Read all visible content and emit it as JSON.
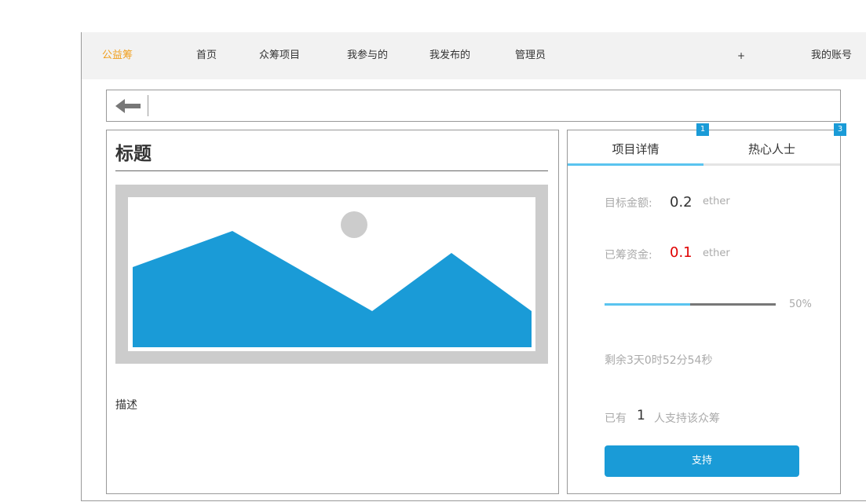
{
  "navbar": {
    "brand": "公益筹",
    "items": [
      "首页",
      "众筹项目",
      "我参与的",
      "我发布的",
      "管理员"
    ],
    "plus": "+",
    "account": "我的账号",
    "brand_color": "#f0a020",
    "background": "#f2f2f2"
  },
  "back": {
    "icon": "arrow-left-icon"
  },
  "project": {
    "title": "标题",
    "image_icon": "image-placeholder-icon",
    "description": "描述"
  },
  "tabs": {
    "items": [
      {
        "label": "项目详情",
        "badge": "1"
      },
      {
        "label": "热心人士",
        "badge": "3"
      }
    ],
    "active_index": 0,
    "accent": "#5ac4ef"
  },
  "details": {
    "target_label": "目标金额:",
    "target_value": "0.2",
    "target_unit": "ether",
    "raised_label": "已筹资金:",
    "raised_value": "0.1",
    "raised_unit": "ether",
    "raised_color": "#e00000",
    "progress_percent": 50,
    "progress_text": "50%",
    "countdown": "剩余3天0时52分54秒",
    "supporters_prefix": "已有",
    "supporters_count": "1",
    "supporters_suffix": "人支持该众筹"
  },
  "actions": {
    "support_label": "支持",
    "button_color": "#1a9bd7"
  }
}
